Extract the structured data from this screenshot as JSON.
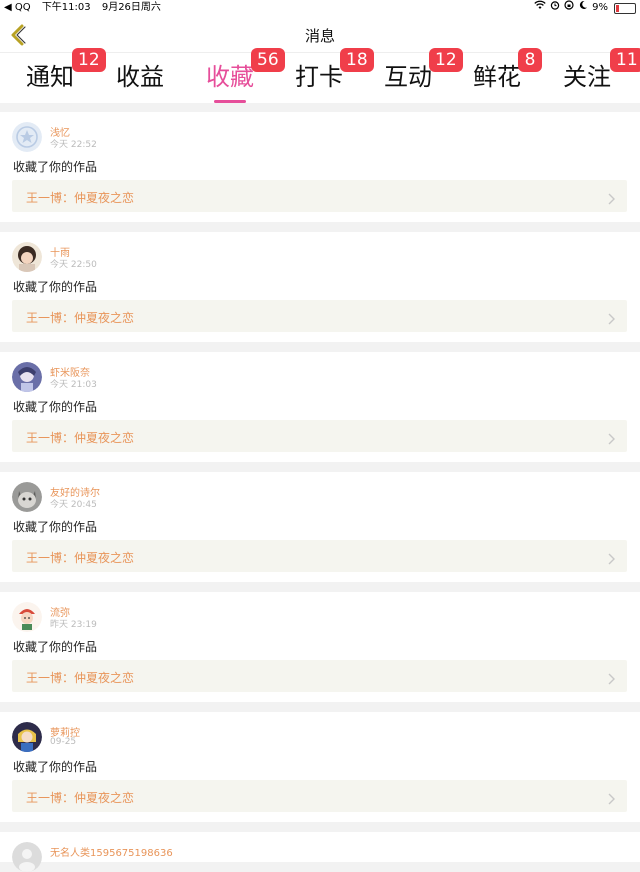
{
  "status_bar": {
    "back_app": "◀ QQ",
    "time": "下午11:03",
    "date": "9月26日周六",
    "battery": "9%"
  },
  "header": {
    "title": "消息"
  },
  "tabs": [
    {
      "label": "通知",
      "badge": "12"
    },
    {
      "label": "收益",
      "badge": ""
    },
    {
      "label": "收藏",
      "badge": "56",
      "active": true
    },
    {
      "label": "打卡",
      "badge": "18"
    },
    {
      "label": "互动",
      "badge": "12"
    },
    {
      "label": "鲜花",
      "badge": "8"
    },
    {
      "label": "关注",
      "badge": "11"
    }
  ],
  "notifications": [
    {
      "user": "浅忆",
      "time": "今天 22:52",
      "action": "收藏了你的作品",
      "work": "王一博：仲夏夜之恋",
      "avatar": "star-avatar-icon"
    },
    {
      "user": "十雨",
      "time": "今天 22:50",
      "action": "收藏了你的作品",
      "work": "王一博：仲夏夜之恋",
      "avatar": "girl-avatar-icon"
    },
    {
      "user": "虾米阪奈",
      "time": "今天 21:03",
      "action": "收藏了你的作品",
      "work": "王一博：仲夏夜之恋",
      "avatar": "anime-avatar-icon"
    },
    {
      "user": "友好的诗尔",
      "time": "今天 20:45",
      "action": "收藏了你的作品",
      "work": "王一博：仲夏夜之恋",
      "avatar": "cat-avatar-icon"
    },
    {
      "user": "流弥",
      "time": "昨天 23:19",
      "action": "收藏了你的作品",
      "work": "王一博：仲夏夜之恋",
      "avatar": "cartoon-avatar-icon"
    },
    {
      "user": "萝莉控",
      "time": "09-25",
      "action": "收藏了你的作品",
      "work": "王一博：仲夏夜之恋",
      "avatar": "anime2-avatar-icon"
    },
    {
      "user": "无名人类1595675198636",
      "time": "",
      "action": "",
      "work": "",
      "avatar": "default-avatar-icon"
    }
  ],
  "colors": {
    "accent": "#e64e9a",
    "badge": "#f03e4a",
    "username": "#e8955a",
    "card_bg": "#f5f5ef"
  }
}
